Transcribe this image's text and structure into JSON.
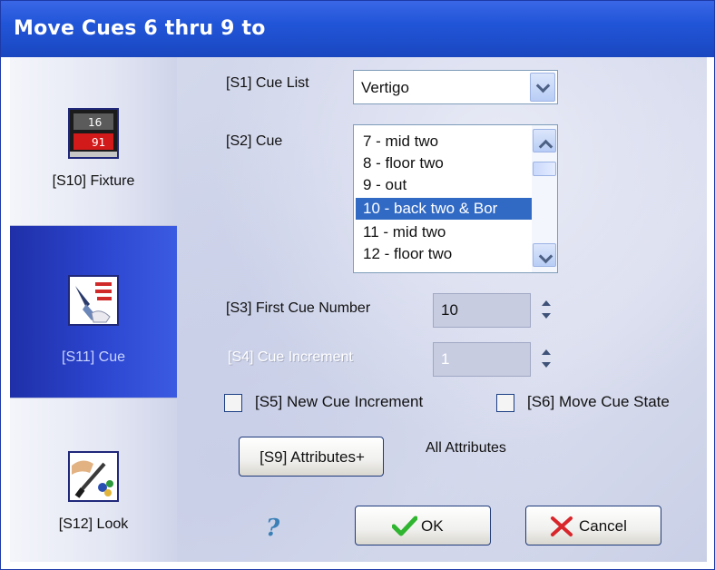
{
  "window": {
    "title": "Move Cues 6 thru 9 to"
  },
  "sidebar": {
    "items": [
      {
        "label": "[S10] Fixture",
        "icon": "fixture-icon"
      },
      {
        "label": "[S11] Cue",
        "icon": "cue-icon"
      },
      {
        "label": "[S12] Look",
        "icon": "look-icon"
      }
    ],
    "fixture_icon_text": {
      "top": "16",
      "bottom": "91"
    }
  },
  "form": {
    "cue_list_label": "[S1] Cue List",
    "cue_list_value": "Vertigo",
    "cue_label": "[S2] Cue",
    "cue_items": [
      "7 - mid two",
      "8 - floor two",
      "9 - out",
      "10 - back two & Bor",
      "11 - mid two",
      "12 - floor two"
    ],
    "first_cue_label": "[S3] First Cue Number",
    "first_cue_value": "10",
    "cue_increment_label": "[S4] Cue Increment",
    "cue_increment_value": "1",
    "new_cue_increment_label": "[S5] New Cue Increment",
    "move_cue_state_label": "[S6] Move Cue State",
    "attributes_button": "[S9] Attributes+",
    "attributes_text": "All Attributes",
    "help": "?",
    "ok": "OK",
    "cancel": "Cancel"
  },
  "colors": {
    "title_bar": "#2155d8",
    "selection": "#316ac5",
    "sidebar_active": "#2c46d0",
    "ok_check": "#2fb52f",
    "cancel_x": "#d8262b"
  }
}
